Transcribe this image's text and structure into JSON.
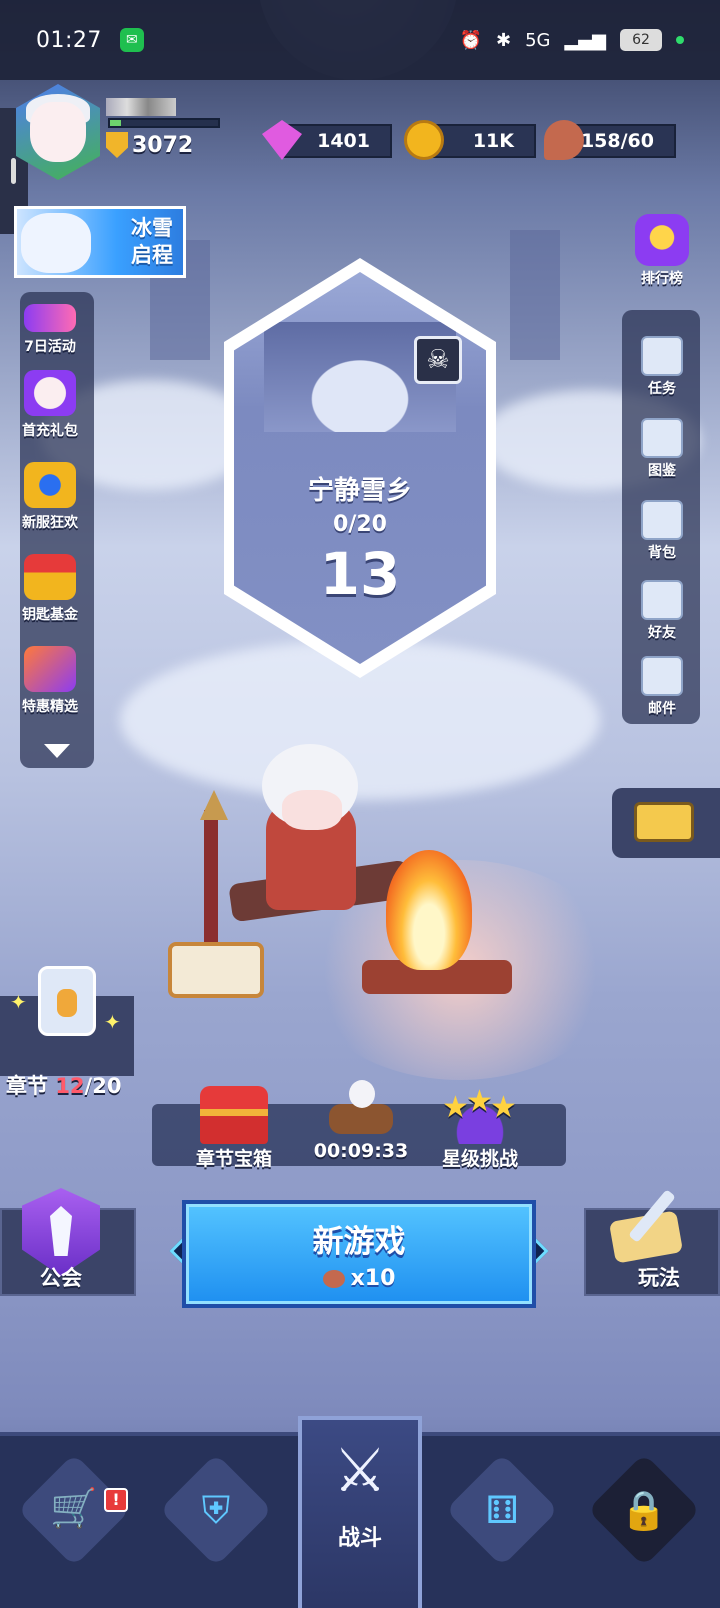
{
  "status_bar": {
    "time": "01:27",
    "network": "5G",
    "battery": "62"
  },
  "player": {
    "trophies": "3072"
  },
  "resources": {
    "gems": "1401",
    "gold": "11K",
    "stamina": "158/60"
  },
  "event_banner": {
    "line1": "冰雪",
    "line2": "启程"
  },
  "left_menu": [
    {
      "label": "7日活动",
      "icon": "seven-day-icon"
    },
    {
      "label": "首充礼包",
      "icon": "first-recharge-icon"
    },
    {
      "label": "新服狂欢",
      "icon": "new-server-icon"
    },
    {
      "label": "钥匙基金",
      "icon": "key-fund-icon"
    },
    {
      "label": "特惠精选",
      "icon": "special-offer-icon"
    }
  ],
  "right_menu": {
    "leaderboard": "排行榜",
    "items": [
      {
        "label": "任务",
        "icon": "task-icon"
      },
      {
        "label": "图鉴",
        "icon": "codex-icon"
      },
      {
        "label": "背包",
        "icon": "backpack-icon"
      },
      {
        "label": "好友",
        "icon": "friends-icon"
      },
      {
        "label": "邮件",
        "icon": "mail-icon"
      }
    ]
  },
  "stage": {
    "name": "宁静雪乡",
    "progress": "0/20",
    "number": "13"
  },
  "chapter": {
    "label": "章节",
    "current": "12",
    "total": "/20"
  },
  "mid_bar": {
    "chest_label": "章节宝箱",
    "timer": "00:09:33",
    "star_label": "星级挑战"
  },
  "actions": {
    "guild": "公会",
    "new_game": "新游戏",
    "cost": "x10",
    "gameplay": "玩法"
  },
  "bottom_nav": {
    "battle": "战斗",
    "shop_badge": "!"
  },
  "colors": {
    "primary_button": "#1e8ff0",
    "chapter_current": "#ff5a6a",
    "badge": "#e83a3a"
  }
}
